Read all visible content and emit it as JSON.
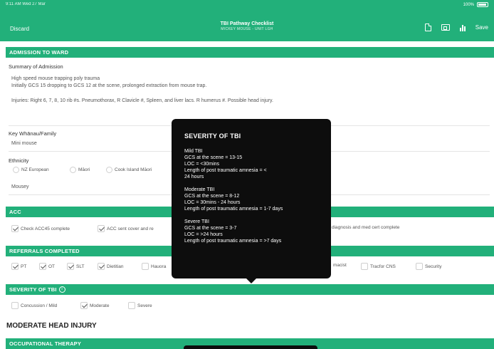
{
  "status": {
    "time": "9:11 AM   Wed 27 Mar",
    "right": "100%"
  },
  "header": {
    "discard": "Discard",
    "title": "TBI Pathway Checklist",
    "subtitle": "MICKEY MOUSE - UNIT LGH",
    "save": "Save"
  },
  "admission": {
    "bar": "ADMISSION TO WARD",
    "summary_label": "Summary of Admission",
    "line1": "High speed mouse trapping poly trauma",
    "line2": "Initially GCS 15 dropping to GCS 12 at the scene, prolonged extraction from mouse trap.",
    "line3": "Injuries: Right 6, 7, 8, 10 rib #s. Pneumothorax, R Clavicle #, Spleen, and liver lacs. R humerus #. Possible head injury.",
    "key_label": "Key Whānau/Family",
    "key_value": "Mini mouse",
    "ethnicity_label": "Ethnicity",
    "ethnicity_options": [
      "NZ European",
      "Māori",
      "Cook Island Māori"
    ],
    "ethnicity_value": "Mousey"
  },
  "acc": {
    "bar": "ACC",
    "item1": "Check ACC45 complete",
    "item2": "ACC sent cover and re",
    "item3": "diagnosis and med cert complete"
  },
  "referrals": {
    "bar": "REFERRALS COMPLETED",
    "items": [
      "PT",
      "OT",
      "SLT",
      "Dietitian",
      "Hauora"
    ],
    "right_items": [
      "macist",
      "Tracfor CNS",
      "Security"
    ]
  },
  "severity": {
    "bar": "SEVERITY OF TBI",
    "options": [
      "Concussion / Mild",
      "Moderate",
      "Severe"
    ]
  },
  "heading": "MODERATE HEAD INJURY",
  "ot_bar": "OCCUPATIONAL THERAPY",
  "popup": {
    "title": "SEVERITY OF TBI",
    "mild": [
      "Mild TBI",
      "GCS at the scene = 13-15",
      "LOC = <30mins",
      "Length of post traumatic amnesia = <",
      "24 hours"
    ],
    "moderate": [
      "Moderate TBI",
      "GCS at the scene = 8-12",
      "LOC = 30mins - 24 hours",
      "Length of post traumatic amnesia = 1-7 days"
    ],
    "severe": [
      "Severe TBI",
      "GCS at the scene = 3-7",
      "LOC = >24 hours",
      "Length of post traumatic amnesia = >7 days"
    ]
  },
  "colors": {
    "accent": "#22b07a",
    "popup": "#0d0d0d"
  }
}
